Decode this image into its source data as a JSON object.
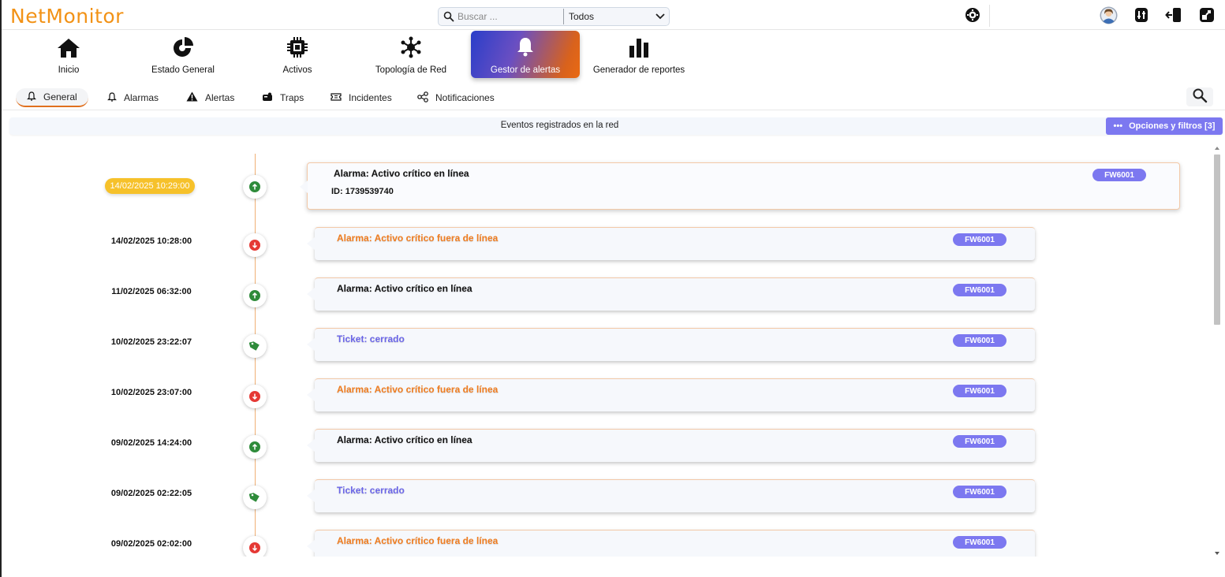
{
  "app": {
    "logo_text": "NetMonitor",
    "brand_color": "#f29216"
  },
  "header": {
    "search_placeholder": "Buscar ...",
    "scope_value": "Todos",
    "icons": [
      "settings-icon",
      "user-avatar",
      "device-icon",
      "logout-icon",
      "expand-icon"
    ]
  },
  "nav": {
    "items": [
      {
        "label": "Inicio",
        "icon": "home-icon"
      },
      {
        "label": "Estado General",
        "icon": "pie-icon"
      },
      {
        "label": "Activos",
        "icon": "chip-icon"
      },
      {
        "label": "Topología de Red",
        "icon": "topology-icon"
      },
      {
        "label": "Gestor de alertas",
        "icon": "bell-icon",
        "active": true
      },
      {
        "label": "Generador de reportes",
        "icon": "bar-chart-icon"
      }
    ]
  },
  "subnav": {
    "items": [
      {
        "label": "General",
        "icon": "bell-icon",
        "active": true
      },
      {
        "label": "Alarmas",
        "icon": "bell-icon"
      },
      {
        "label": "Alertas",
        "icon": "warning-icon"
      },
      {
        "label": "Traps",
        "icon": "trap-icon"
      },
      {
        "label": "Incidentes",
        "icon": "ticket-icon"
      },
      {
        "label": "Notificaciones",
        "icon": "share-icon"
      }
    ]
  },
  "events": {
    "title": "Eventos registrados en la red",
    "options_label": "Opciones y filtros [3]",
    "items": [
      {
        "date": "14/02/2025 10:29:00",
        "title": "Alarma: Activo crítico en línea",
        "id_text": "ID: 1739539740",
        "badge": "FW6001",
        "kind": "up",
        "title_color": "black",
        "highlight": true
      },
      {
        "date": "14/02/2025 10:28:00",
        "title": "Alarma: Activo crítico fuera de línea",
        "badge": "FW6001",
        "kind": "down",
        "title_color": "orange"
      },
      {
        "date": "11/02/2025 06:32:00",
        "title": "Alarma: Activo crítico en línea",
        "badge": "FW6001",
        "kind": "up",
        "title_color": "black"
      },
      {
        "date": "10/02/2025 23:22:07",
        "title": "Ticket: cerrado",
        "badge": "FW6001",
        "kind": "tag",
        "title_color": "purple"
      },
      {
        "date": "10/02/2025 23:07:00",
        "title": "Alarma: Activo crítico fuera de línea",
        "badge": "FW6001",
        "kind": "down",
        "title_color": "orange"
      },
      {
        "date": "09/02/2025 14:24:00",
        "title": "Alarma: Activo crítico en línea",
        "badge": "FW6001",
        "kind": "up",
        "title_color": "black"
      },
      {
        "date": "09/02/2025 02:22:05",
        "title": "Ticket: cerrado",
        "badge": "FW6001",
        "kind": "tag",
        "title_color": "purple"
      },
      {
        "date": "09/02/2025 02:02:00",
        "title": "Alarma: Activo crítico fuera de línea",
        "badge": "FW6001",
        "kind": "down",
        "title_color": "orange"
      }
    ]
  },
  "colors": {
    "up": "#2e8b3a",
    "down": "#e53935",
    "tag": "#2e8b3a",
    "accent": "#7c78f0",
    "orange": "#f07d20"
  }
}
